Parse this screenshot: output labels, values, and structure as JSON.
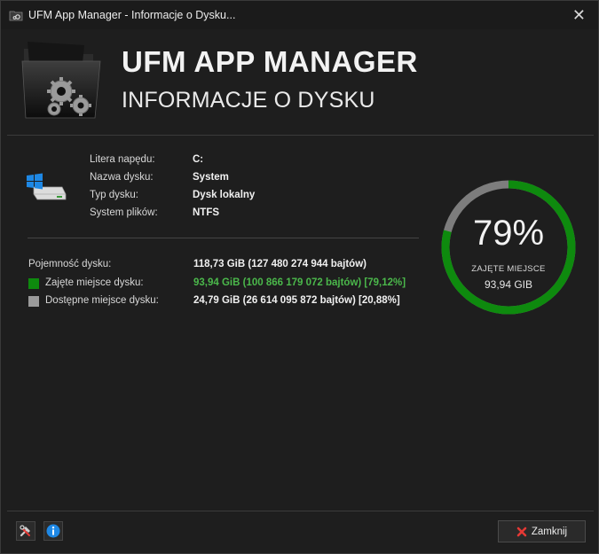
{
  "window": {
    "title": "UFM App Manager - Informacje o Dysku..."
  },
  "header": {
    "app_name": "UFM APP MANAGER",
    "subtitle": "INFORMACJE O DYSKU"
  },
  "drive_info": [
    {
      "label": "Litera napędu:",
      "value": "C:"
    },
    {
      "label": "Nazwa dysku:",
      "value": "System"
    },
    {
      "label": "Typ dysku:",
      "value": "Dysk lokalny"
    },
    {
      "label": "System plików:",
      "value": "NTFS"
    }
  ],
  "capacity": {
    "total": {
      "label": "Pojemność dysku:",
      "value": "118,73 GiB (127 480 274 944 bajtów)"
    },
    "used": {
      "label": "Zajęte miejsce dysku:",
      "value": "93,94 GiB (100 866 179 072 bajtów) [79,12%]"
    },
    "free": {
      "label": "Dostępne miejsce dysku:",
      "value": "24,79 GiB (26 614 095 872 bajtów) [20,88%]"
    }
  },
  "gauge": {
    "percent_text": "79%",
    "used_fraction": 0.7912,
    "label": "ZAJĘTE MIEJSCE",
    "value": "93,94 GIB"
  },
  "colors": {
    "used": "#0e8a0e",
    "free": "#9a9a9a",
    "used_text": "#4bb84b"
  },
  "footer": {
    "close_label": "Zamknij",
    "icons": [
      "tools-icon",
      "info-icon"
    ]
  }
}
